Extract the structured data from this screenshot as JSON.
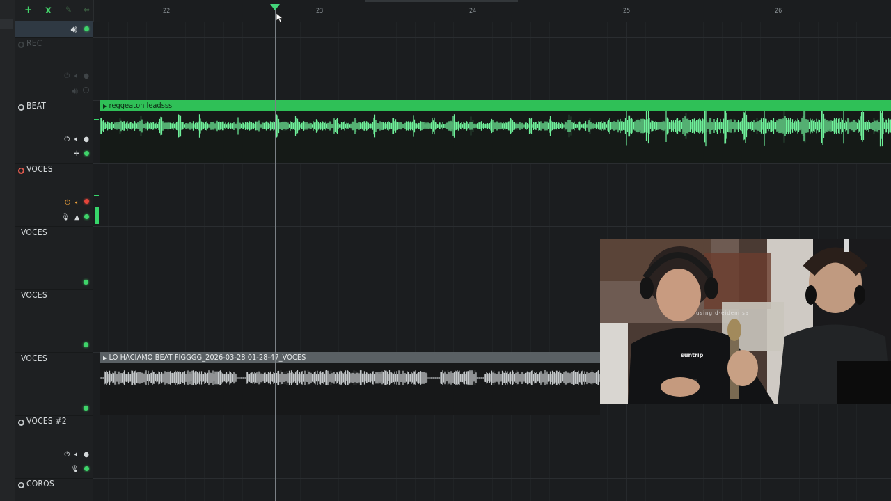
{
  "toolbar": {
    "add_icon": "+",
    "close_icon": "x",
    "pencil_icon": "✎",
    "arrows_icon": "⇔"
  },
  "ruler": {
    "bars": [
      "22",
      "23",
      "24",
      "25",
      "26"
    ]
  },
  "tracks": [
    {
      "name": "REC",
      "dim": true
    },
    {
      "name": "BEAT",
      "arm": "white"
    },
    {
      "name": "VOCES",
      "arm": "red"
    },
    {
      "name": "VOCES"
    },
    {
      "name": "VOCES"
    },
    {
      "name": "VOCES"
    },
    {
      "name": "VOCES #2",
      "arm": "white"
    },
    {
      "name": "COROS",
      "arm": "white"
    }
  ],
  "clips": {
    "beat": {
      "title": "reggeaton leadsss",
      "color": "#2fc057",
      "wave_color": "#6ff09a"
    },
    "voces": {
      "title": "LO HACIAMO BEAT FIGGGG_2026-03-28 01-28-47_VOCES",
      "color": "#5a6064",
      "wave_color": "#c4c8ca"
    }
  },
  "webcam": {
    "caption": "using d-eidem sa",
    "shirt_brand": "suntrip"
  },
  "colors": {
    "accent": "#44d67a",
    "record": "#e5453a",
    "warning": "#f0a23a"
  }
}
